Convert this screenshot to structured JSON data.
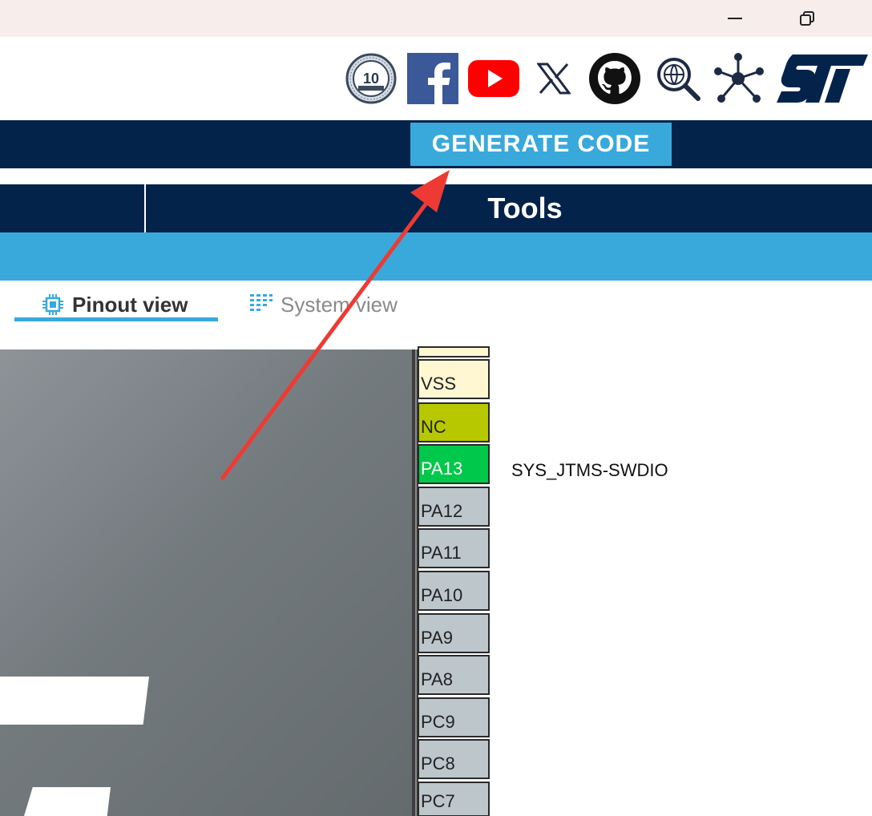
{
  "window": {
    "minimize_icon": "minimize-icon",
    "maximize_icon": "restore-icon"
  },
  "header_icons": [
    {
      "name": "anniversary-10-years-badge-icon"
    },
    {
      "name": "facebook-icon"
    },
    {
      "name": "youtube-icon"
    },
    {
      "name": "x-twitter-icon"
    },
    {
      "name": "github-icon"
    },
    {
      "name": "web-search-icon"
    },
    {
      "name": "network-share-icon"
    },
    {
      "name": "st-logo"
    }
  ],
  "toolbar": {
    "generate_label": "GENERATE CODE"
  },
  "menu": {
    "tools_label": "Tools"
  },
  "tabs": {
    "pinout_label": "Pinout view",
    "system_label": "System view"
  },
  "pins": [
    {
      "name": "",
      "state": "power",
      "color": "#fff7d2"
    },
    {
      "name": "VSS",
      "state": "power",
      "color": "#fff7d2"
    },
    {
      "name": "NC",
      "state": "nc",
      "color": "#b8c800"
    },
    {
      "name": "PA13",
      "state": "configured",
      "color": "#00c84a",
      "signal": "SYS_JTMS-SWDIO"
    },
    {
      "name": "PA12",
      "state": "free",
      "color": "#bcc6cb"
    },
    {
      "name": "PA11",
      "state": "free",
      "color": "#bcc6cb"
    },
    {
      "name": "PA10",
      "state": "free",
      "color": "#bcc6cb"
    },
    {
      "name": "PA9",
      "state": "free",
      "color": "#bcc6cb"
    },
    {
      "name": "PA8",
      "state": "free",
      "color": "#bcc6cb"
    },
    {
      "name": "PC9",
      "state": "free",
      "color": "#bcc6cb"
    },
    {
      "name": "PC8",
      "state": "free",
      "color": "#bcc6cb"
    },
    {
      "name": "PC7",
      "state": "free",
      "color": "#bcc6cb"
    }
  ],
  "colors": {
    "navy": "#03234b",
    "accent": "#39a9dc",
    "arrow": "#ee3a32"
  }
}
